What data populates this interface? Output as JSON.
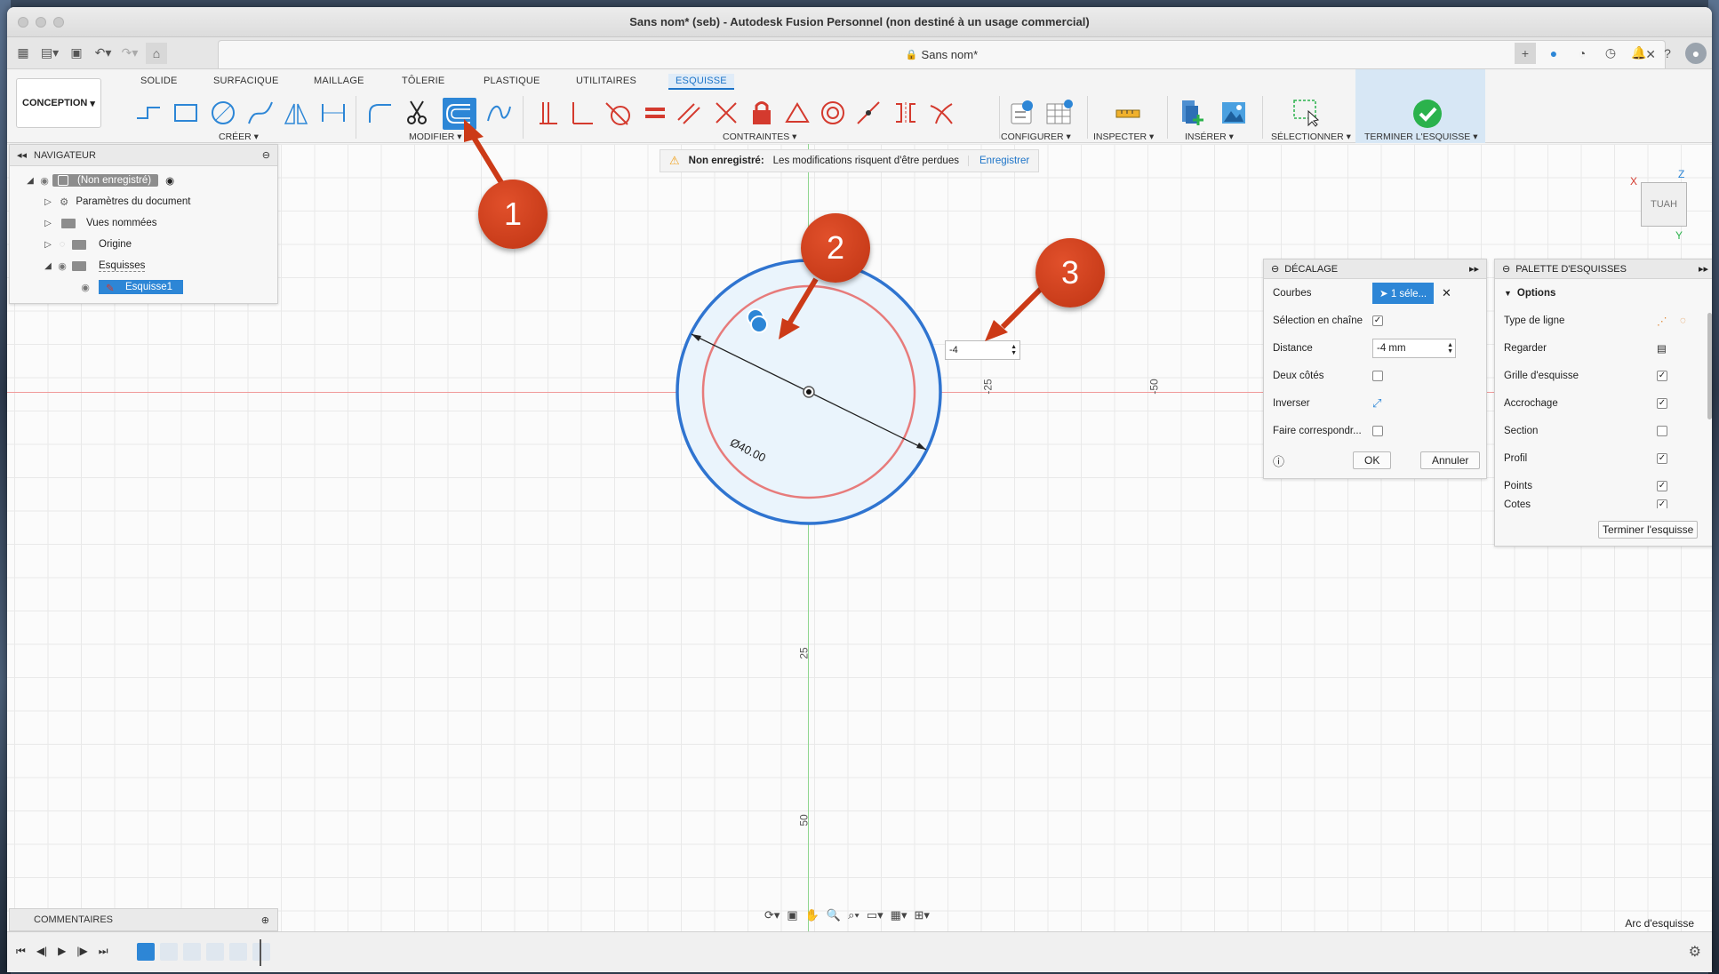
{
  "window": {
    "title": "Sans nom* (seb) - Autodesk Fusion Personnel (non destiné à un usage commercial)"
  },
  "document_tab": {
    "label": "Sans nom*",
    "lock_icon": "lock-icon"
  },
  "workspace": {
    "label": "CONCEPTION"
  },
  "ribbon_tabs": [
    "SOLIDE",
    "SURFACIQUE",
    "MAILLAGE",
    "TÔLERIE",
    "PLASTIQUE",
    "UTILITAIRES",
    "ESQUISSE"
  ],
  "active_tab": "ESQUISSE",
  "tool_groups": {
    "create": "CRÉER",
    "modify": "MODIFIER",
    "constraints": "CONTRAINTES",
    "configure": "CONFIGURER",
    "inspect": "INSPECTER",
    "insert": "INSÉRER",
    "select": "SÉLECTIONNER",
    "finish": "TERMINER L'ESQUISSE"
  },
  "navigator": {
    "header": "NAVIGATEUR",
    "items": [
      {
        "label": "(Non enregistré)"
      },
      {
        "label": "Paramètres du document"
      },
      {
        "label": "Vues nommées"
      },
      {
        "label": "Origine"
      },
      {
        "label": "Esquisses"
      },
      {
        "label": "Esquisse1"
      }
    ]
  },
  "warning": {
    "title": "Non enregistré:",
    "message": "Les modifications risquent d'être perdues",
    "action": "Enregistrer"
  },
  "offset_dialog": {
    "title": "DÉCALAGE",
    "rows": {
      "curves_label": "Courbes",
      "curves_value": "1 séle...",
      "chain_label": "Sélection en chaîne",
      "distance_label": "Distance",
      "distance_value": "-4 mm",
      "both_sides_label": "Deux côtés",
      "flip_label": "Inverser",
      "match_label": "Faire correspondr..."
    },
    "ok": "OK",
    "cancel": "Annuler"
  },
  "sketch_palette": {
    "title": "PALETTE D'ESQUISSES",
    "section": "Options",
    "options": [
      {
        "label": "Type de ligne",
        "kind": "icons"
      },
      {
        "label": "Regarder",
        "kind": "icon"
      },
      {
        "label": "Grille d'esquisse",
        "checked": true
      },
      {
        "label": "Accrochage",
        "checked": true
      },
      {
        "label": "Section",
        "checked": false
      },
      {
        "label": "Profil",
        "checked": true
      },
      {
        "label": "Points",
        "checked": true
      },
      {
        "label": "Cotes",
        "checked": true
      }
    ],
    "finish_button": "Terminer l'esquisse"
  },
  "canvas": {
    "dimension": "Ø40.00",
    "offset_input": "-4",
    "axis_labels": {
      "h_neg25": "-25",
      "h_neg50": "-50",
      "v_25": "25",
      "v_50": "50"
    },
    "viewcube": "HAUT",
    "triad": {
      "x": "X",
      "y": "Y",
      "z": "Z"
    }
  },
  "callouts": [
    "1",
    "2",
    "3"
  ],
  "comments": {
    "label": "COMMENTAIRES"
  },
  "status": {
    "right_text": "Arc d'esquisse"
  },
  "colors": {
    "accent": "#2d86d6",
    "callout": "#cc3a17",
    "circle": "#2f74d0",
    "offset_circle": "#e77b7b",
    "finish_check": "#2bb24c"
  }
}
